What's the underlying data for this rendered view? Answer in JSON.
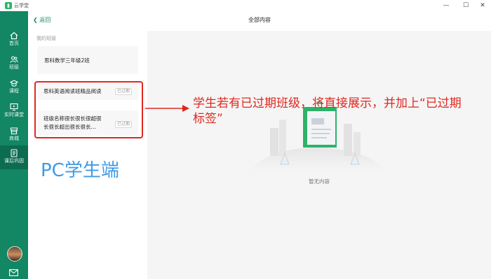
{
  "window": {
    "app_title": "云学堂",
    "minimize": "—",
    "maximize": "☐",
    "close": "✕"
  },
  "sidebar": {
    "items": [
      {
        "label": "首页",
        "icon": "home-icon"
      },
      {
        "label": "班级",
        "icon": "users-icon"
      },
      {
        "label": "课程",
        "icon": "graduation-cap-icon"
      },
      {
        "label": "实时课堂",
        "icon": "live-class-icon"
      },
      {
        "label": "商城",
        "icon": "store-icon"
      },
      {
        "label": "课后巩固",
        "icon": "homework-icon"
      }
    ],
    "active_index": 5
  },
  "header": {
    "back_label": "返回",
    "title": "全部内容"
  },
  "classes": {
    "section_label": "我的班级",
    "items": [
      {
        "name": "思科数学三年级2班",
        "badge": ""
      },
      {
        "name": "思科英语阅读班精品阅读",
        "badge": "已过期"
      },
      {
        "name_line1": "班级名称很长很长很超很",
        "name_line2": "长很长超出很长很长...",
        "badge": "已过期"
      }
    ]
  },
  "main": {
    "empty_text": "暂无内容"
  },
  "annotation": {
    "line1": "学生若有已过期班级，将直接展示，并加上“已过期",
    "line2": "标签”",
    "platform_label": "PC学生端"
  },
  "colors": {
    "primary": "#138663",
    "annotation": "#e0271f",
    "platform_label": "#3f9ae6",
    "illustration": "#2db36a"
  }
}
